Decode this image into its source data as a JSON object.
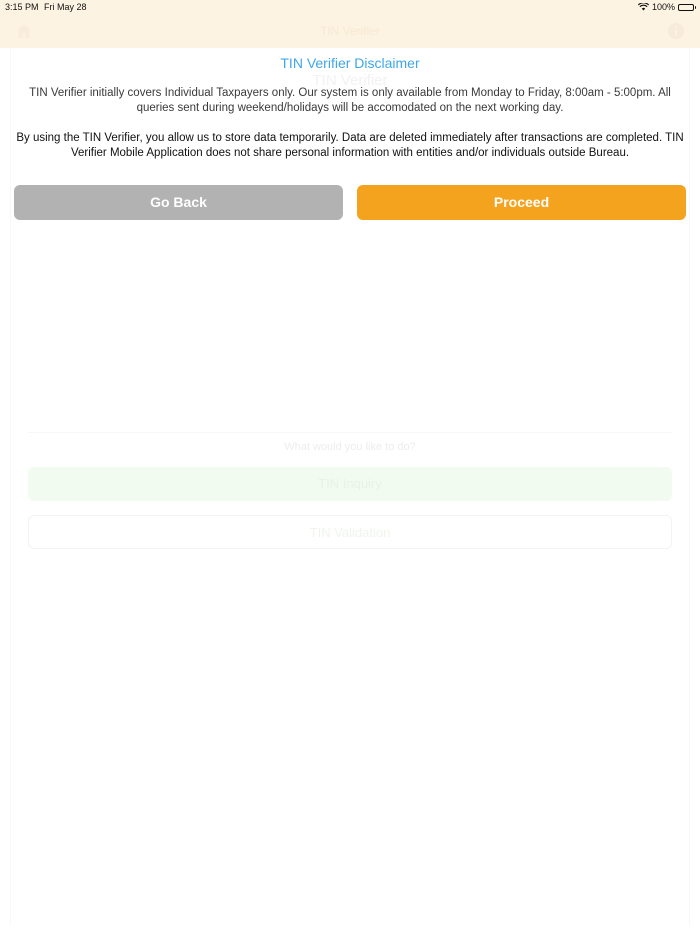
{
  "status_bar": {
    "time": "3:15 PM",
    "date": "Fri May 28",
    "battery": "100%"
  },
  "nav_bar": {
    "title": "TIN Verifier"
  },
  "background": {
    "title": "TIN Verifier",
    "question": "What would you like to do?",
    "inquiry_label": "TIN Inquiry",
    "validation_label": "TIN Validation"
  },
  "disclaimer": {
    "title": "TIN Verifier Disclaimer",
    "paragraph1": "TIN Verifier initially covers Individual Taxpayers only. Our system is only available from Monday to Friday, 8:00am - 5:00pm. All queries sent during weekend/holidays will be accomodated on the next working day.",
    "paragraph2": "By using the TIN Verifier, you allow us to store data temporarily. Data are deleted immediately after transactions are completed. TIN Verifier Mobile Application does not share personal information with entities and/or individuals outside Bureau."
  },
  "buttons": {
    "back_label": "Go Back",
    "proceed_label": "Proceed"
  },
  "colors": {
    "accent_blue": "#3fa7e8",
    "proceed_orange": "#f3a31d",
    "back_gray": "#b2b2b2",
    "header_cream": "#fdf3e2"
  },
  "icons": {
    "home": "home-icon",
    "info": "info-icon",
    "wifi": "wifi-icon",
    "battery": "battery-icon"
  }
}
